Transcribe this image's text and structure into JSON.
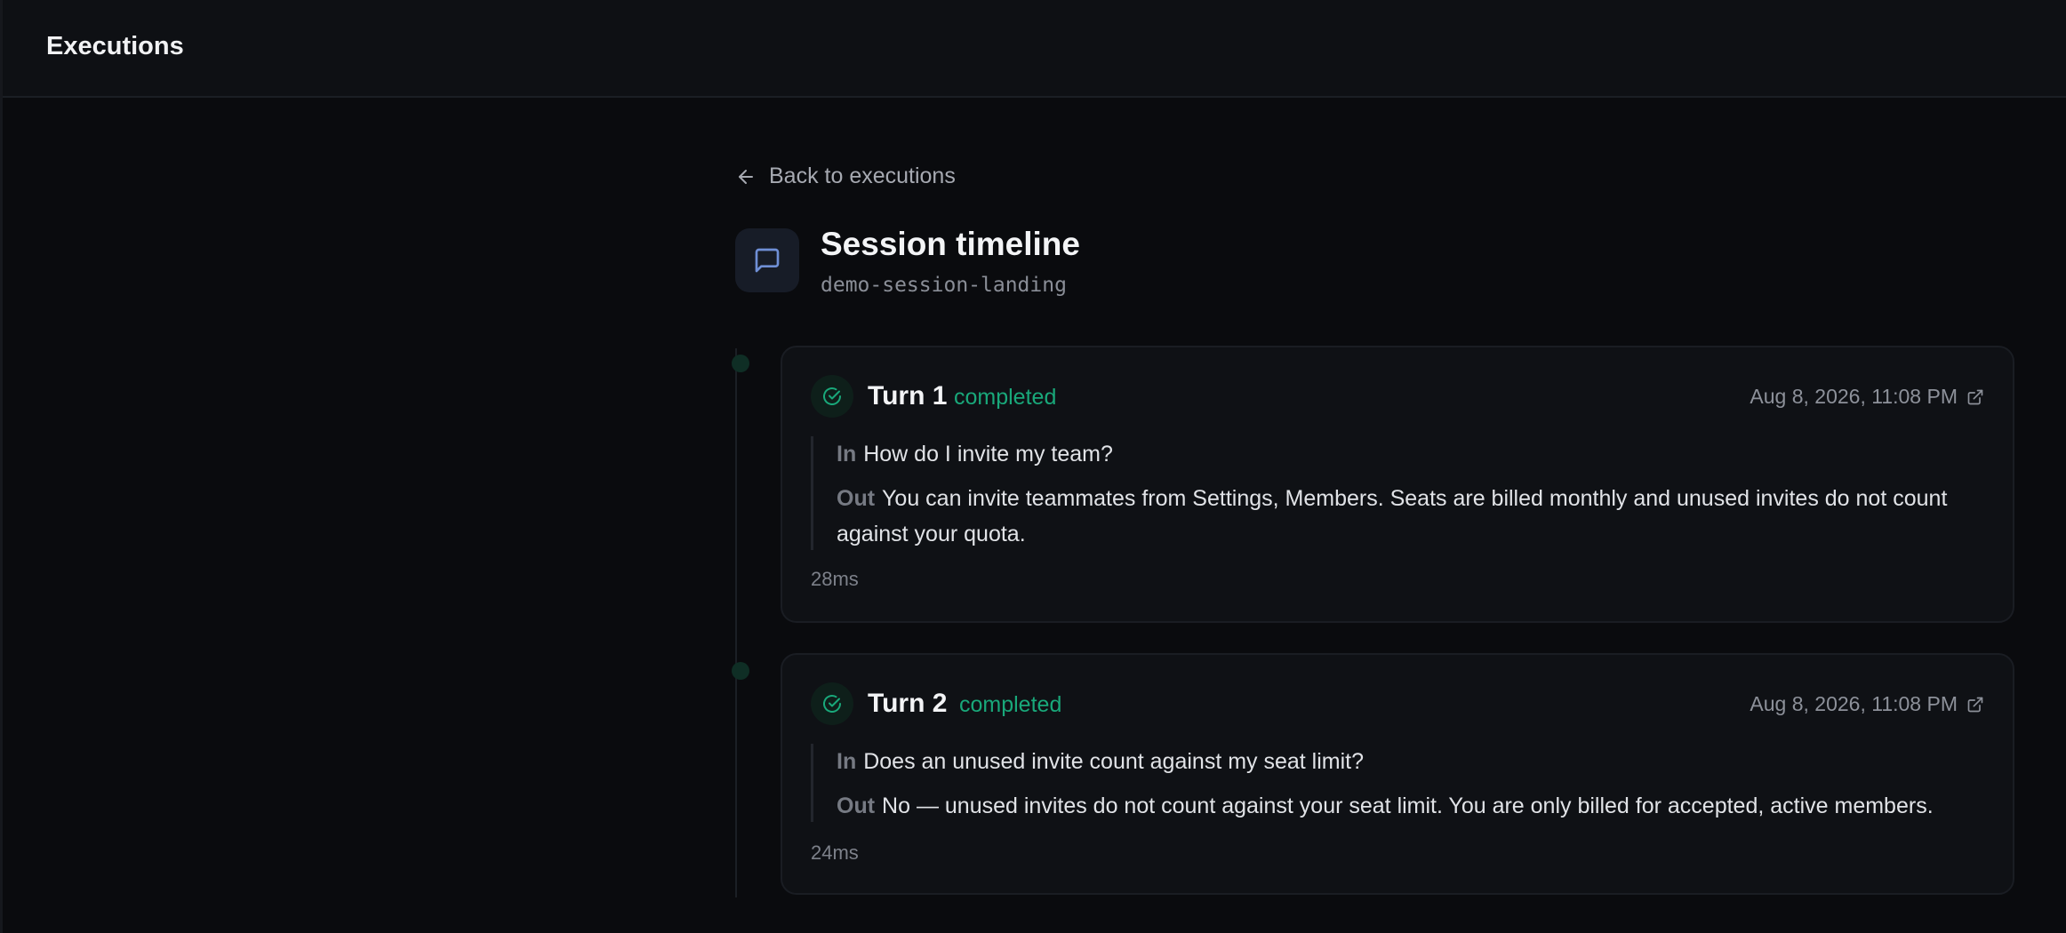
{
  "app": {
    "title": "Executions"
  },
  "nav": {
    "back_label": "Back to executions"
  },
  "header": {
    "title": "Session timeline",
    "session_id": "demo-session-landing",
    "icon": "message-square-icon"
  },
  "colors": {
    "background": "#0a0b0e",
    "card": "#0f1115",
    "status_completed": "#19a87a",
    "accent_icon": "#6f8fd6"
  },
  "turns": [
    {
      "label": "Turn 1",
      "status": "completed",
      "timestamp": "Aug 8, 2026, 11:08 PM",
      "in_tag": "In",
      "input": "How do I invite my team?",
      "out_tag": "Out",
      "output_line1": "You can invite teammates from Settings, Members. Seats are billed monthly and unused invites do not count",
      "output_line2": "against your quota.",
      "duration": "28ms"
    },
    {
      "label": "Turn 2",
      "status": "completed",
      "timestamp": "Aug 8, 2026, 11:08 PM",
      "in_tag": "In",
      "input": "Does an unused invite count against my seat limit?",
      "out_tag": "Out",
      "output_line1": "No — unused invites do not count against your seat limit. You are only billed for accepted, active members.",
      "duration": "24ms"
    }
  ]
}
